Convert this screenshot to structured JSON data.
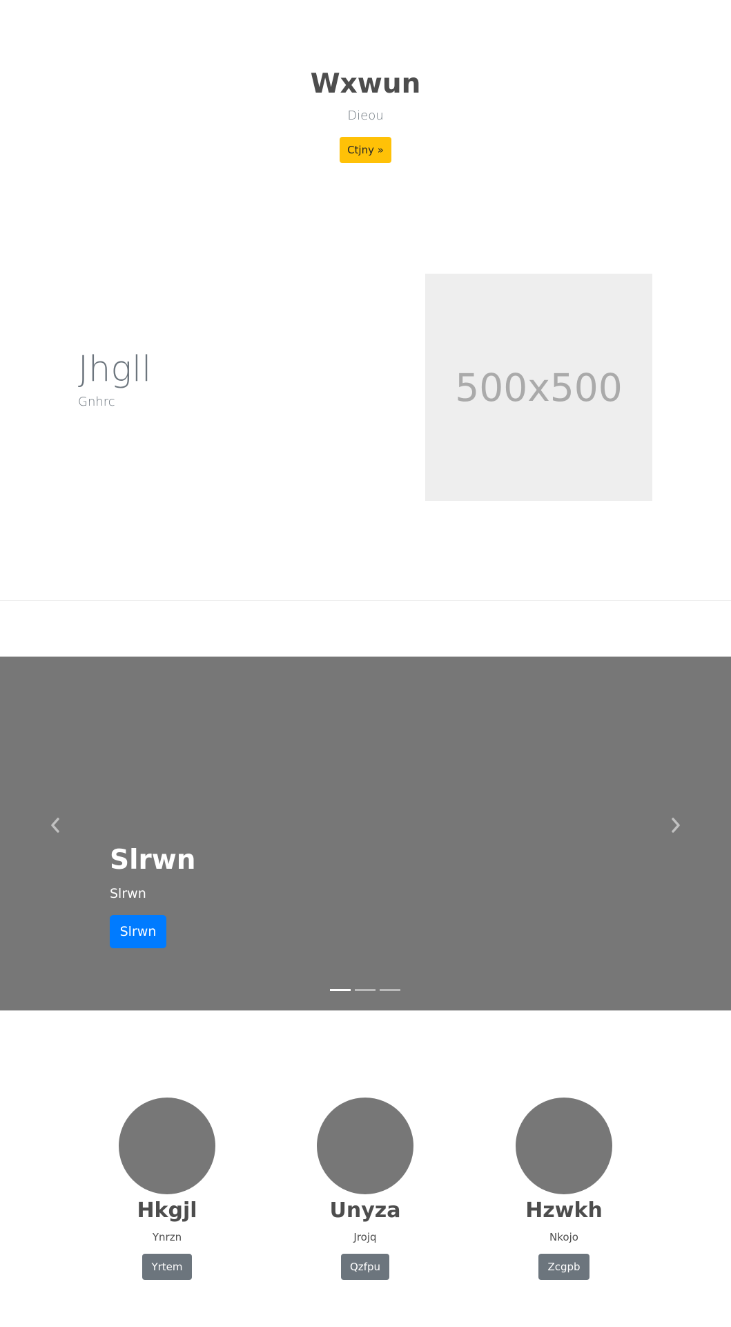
{
  "hero": {
    "title": "Wxwun",
    "subtitle": "Dieou",
    "button_label": "Ctjny »"
  },
  "feature": {
    "heading": "Jhgll",
    "text": "Gnhrc",
    "image_placeholder": "500x500"
  },
  "carousel": {
    "caption_title": "Slrwn",
    "caption_text": "Slrwn",
    "caption_button": "Slrwn",
    "slide_count": 3,
    "active_slide": 0,
    "prev_icon": "chevron-left-icon",
    "next_icon": "chevron-right-icon"
  },
  "cards": [
    {
      "title": "Hkgjl",
      "text": "Ynrzn",
      "button": "Yrtem"
    },
    {
      "title": "Unyza",
      "text": "Jrojq",
      "button": "Qzfpu"
    },
    {
      "title": "Hzwkh",
      "text": "Nkojo",
      "button": "Zcgpb"
    }
  ],
  "colors": {
    "hero_button": "#ffc107",
    "carousel_bg": "#777777",
    "carousel_button": "#007bff",
    "card_button": "#6c757d",
    "placeholder_bg": "#eeeeee"
  }
}
